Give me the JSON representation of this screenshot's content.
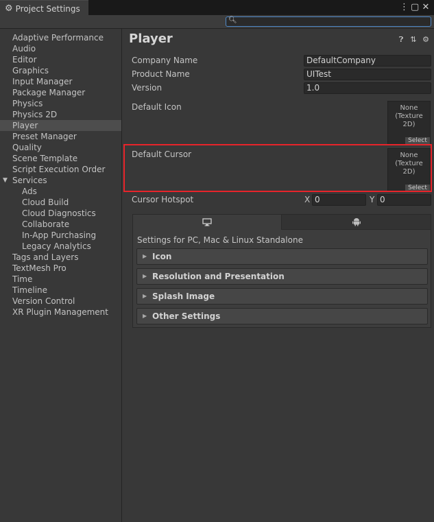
{
  "window": {
    "title": "Project Settings",
    "tab_icon": "gear-icon",
    "controls": [
      "more-options-icon",
      "maximize-icon",
      "close-icon"
    ]
  },
  "search": {
    "value": "",
    "placeholder": ""
  },
  "sidebar": {
    "items": [
      {
        "label": "Adaptive Performance",
        "level": 0
      },
      {
        "label": "Audio",
        "level": 0
      },
      {
        "label": "Editor",
        "level": 0
      },
      {
        "label": "Graphics",
        "level": 0
      },
      {
        "label": "Input Manager",
        "level": 0
      },
      {
        "label": "Package Manager",
        "level": 0
      },
      {
        "label": "Physics",
        "level": 0
      },
      {
        "label": "Physics 2D",
        "level": 0
      },
      {
        "label": "Player",
        "level": 0,
        "selected": true
      },
      {
        "label": "Preset Manager",
        "level": 0
      },
      {
        "label": "Quality",
        "level": 0
      },
      {
        "label": "Scene Template",
        "level": 0
      },
      {
        "label": "Script Execution Order",
        "level": 0
      },
      {
        "label": "Services",
        "level": 0,
        "expanded": true
      },
      {
        "label": "Ads",
        "level": 1
      },
      {
        "label": "Cloud Build",
        "level": 1
      },
      {
        "label": "Cloud Diagnostics",
        "level": 1
      },
      {
        "label": "Collaborate",
        "level": 1
      },
      {
        "label": "In-App Purchasing",
        "level": 1
      },
      {
        "label": "Legacy Analytics",
        "level": 1
      },
      {
        "label": "Tags and Layers",
        "level": 0
      },
      {
        "label": "TextMesh Pro",
        "level": 0
      },
      {
        "label": "Time",
        "level": 0
      },
      {
        "label": "Timeline",
        "level": 0
      },
      {
        "label": "Version Control",
        "level": 0
      },
      {
        "label": "XR Plugin Management",
        "level": 0
      }
    ]
  },
  "main": {
    "title": "Player",
    "header_icons": [
      "help-icon",
      "presets-icon",
      "settings-icon"
    ],
    "company_name": {
      "label": "Company Name",
      "value": "DefaultCompany"
    },
    "product_name": {
      "label": "Product Name",
      "value": "UITest"
    },
    "version": {
      "label": "Version",
      "value": "1.0"
    },
    "default_icon": {
      "label": "Default Icon",
      "value_line1": "None",
      "value_line2": "(Texture 2D)",
      "select": "Select"
    },
    "default_cursor": {
      "label": "Default Cursor",
      "value_line1": "None",
      "value_line2": "(Texture 2D)",
      "select": "Select"
    },
    "cursor_hotspot": {
      "label": "Cursor Hotspot",
      "x_label": "X",
      "x_value": "0",
      "y_label": "Y",
      "y_value": "0"
    },
    "platform": {
      "tabs": [
        {
          "icon": "monitor-icon",
          "active": true
        },
        {
          "icon": "android-icon",
          "active": false
        }
      ],
      "caption": "Settings for PC, Mac & Linux Standalone",
      "sections": [
        "Icon",
        "Resolution and Presentation",
        "Splash Image",
        "Other Settings"
      ]
    }
  },
  "colors": {
    "highlight": "#e8242a",
    "search_border": "#4f89c8"
  }
}
